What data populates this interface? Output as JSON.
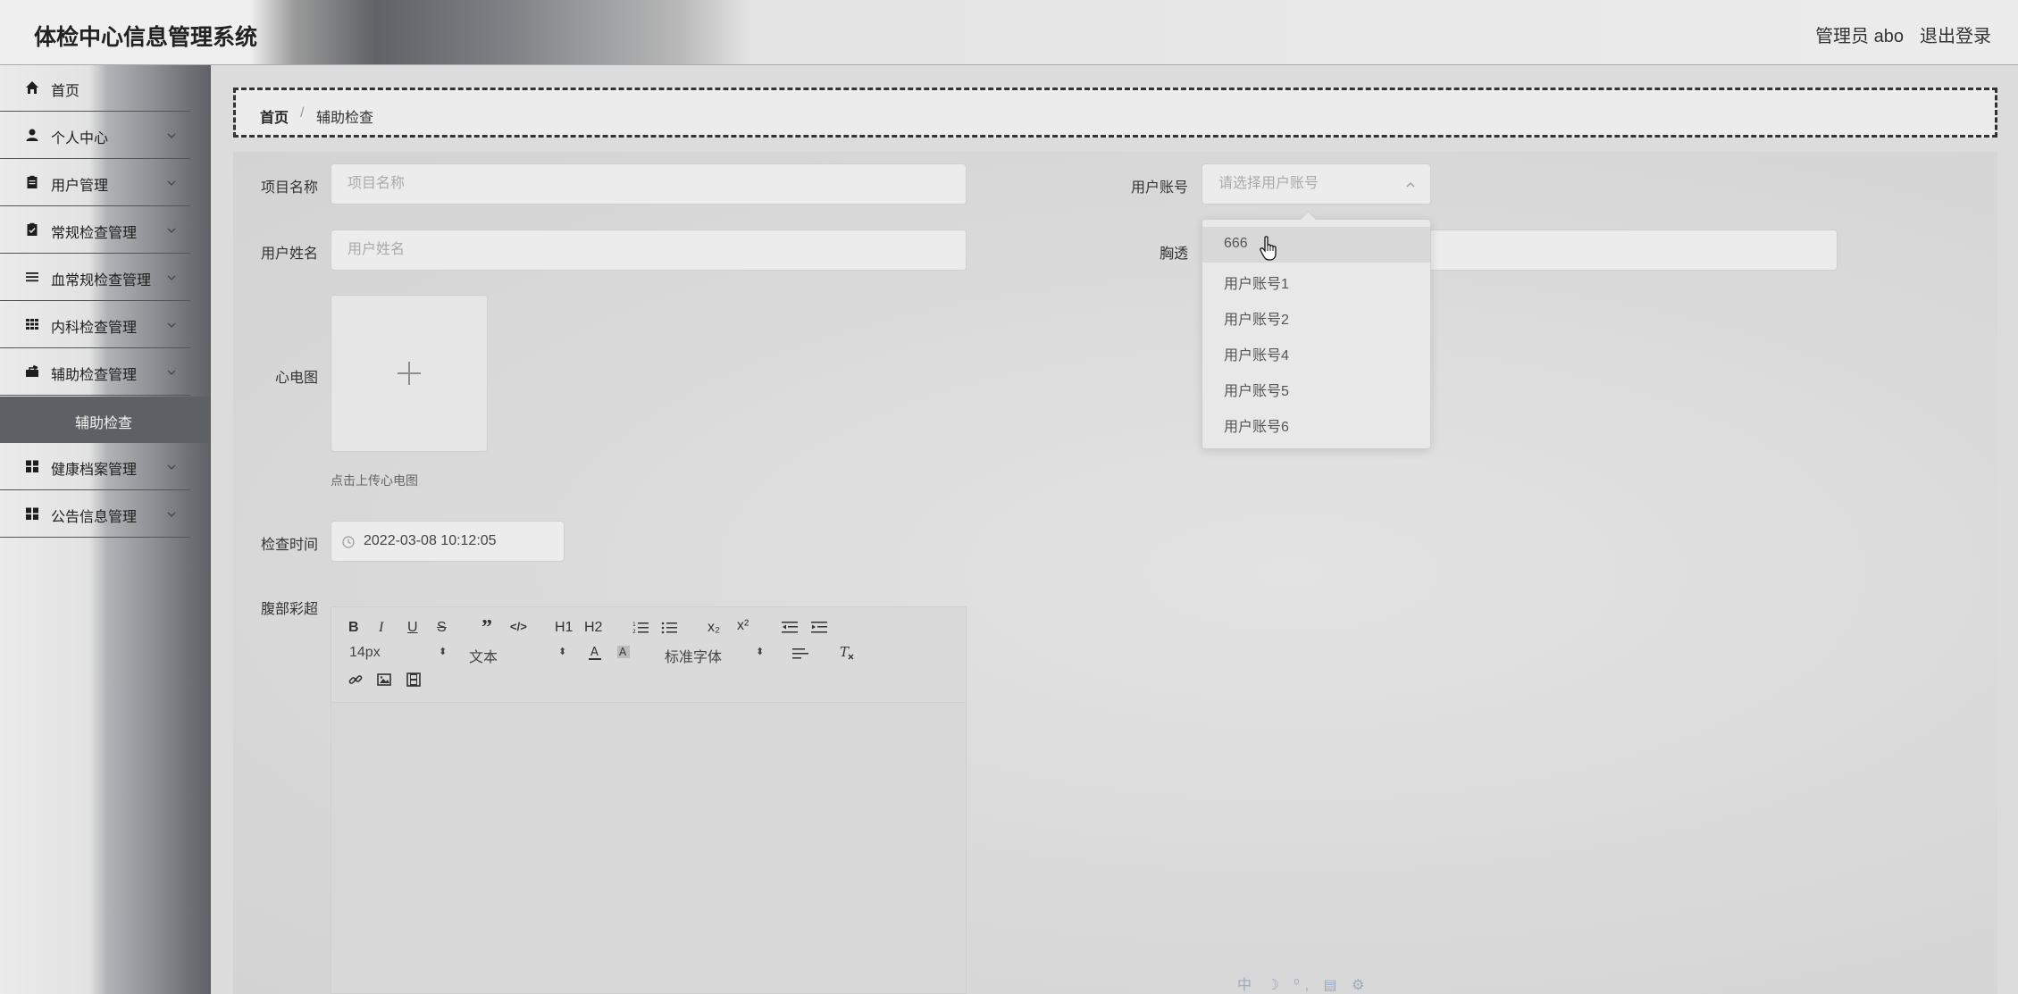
{
  "header": {
    "title": "体检中心信息管理系统",
    "user": "管理员 abo",
    "logout": "退出登录"
  },
  "sidebar": {
    "items": [
      {
        "label": "首页",
        "icon": "home-icon"
      },
      {
        "label": "个人中心",
        "icon": "person-icon"
      },
      {
        "label": "用户管理",
        "icon": "clipboard-icon"
      },
      {
        "label": "常规检查管理",
        "icon": "clipboard-check-icon"
      },
      {
        "label": "血常规检查管理",
        "icon": "list-icon"
      },
      {
        "label": "内科检查管理",
        "icon": "grid-icon"
      },
      {
        "label": "辅助检查管理",
        "icon": "briefcase-icon"
      },
      {
        "label": "健康档案管理",
        "icon": "apps-icon"
      },
      {
        "label": "公告信息管理",
        "icon": "apps-icon"
      }
    ],
    "sub_item": "辅助检查"
  },
  "breadcrumb": {
    "home": "首页",
    "separator": "/",
    "current": "辅助检查"
  },
  "form": {
    "project_name": {
      "label": "项目名称",
      "placeholder": "项目名称"
    },
    "user_account": {
      "label": "用户账号",
      "placeholder": "请选择用户账号"
    },
    "user_name": {
      "label": "用户姓名",
      "placeholder": "用户姓名"
    },
    "chest": {
      "label": "胸透"
    },
    "ecg": {
      "label": "心电图",
      "hint": "点击上传心电图"
    },
    "exam_time": {
      "label": "检查时间",
      "value": "2022-03-08 10:12:05"
    },
    "ultrasound": {
      "label": "腹部彩超"
    }
  },
  "editor_toolbar": {
    "row1": [
      "B",
      "I",
      "U",
      "S",
      "”",
      "</>",
      "H1",
      "H2",
      "ordered-list",
      "bullet-list",
      "x₂",
      "x²",
      "outdent",
      "indent"
    ],
    "font_size": "14px",
    "text_style": "文本",
    "font_family": "标准字体"
  },
  "dropdown": {
    "options": [
      "666",
      "用户账号1",
      "用户账号2",
      "用户账号4",
      "用户账号5",
      "用户账号6"
    ],
    "hovered": "666"
  },
  "ime_bar": "中 ☽ ⁰, ▤ ⚙"
}
